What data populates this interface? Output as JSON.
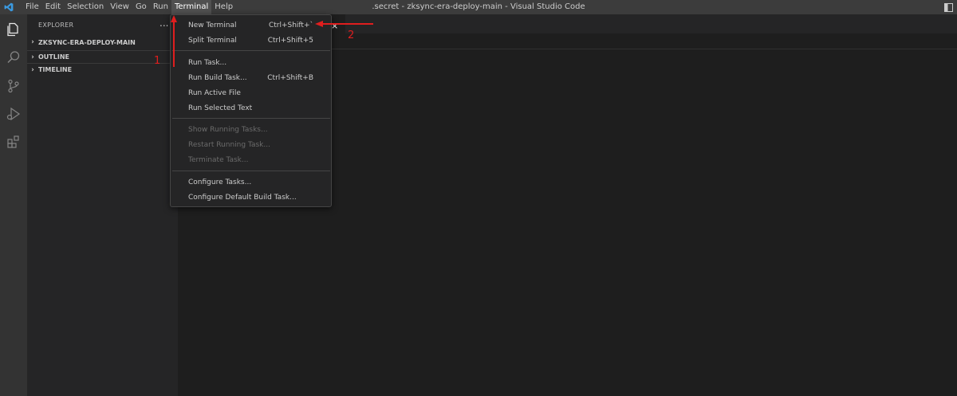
{
  "titlebar": {
    "menu": [
      "File",
      "Edit",
      "Selection",
      "View",
      "Go",
      "Run",
      "Terminal",
      "Help"
    ],
    "active_menu_index": 6,
    "window_title": ".secret - zksync-era-deploy-main - Visual Studio Code"
  },
  "activitybar": {
    "icons": [
      "explorer-icon",
      "search-icon",
      "source-control-icon",
      "run-debug-icon",
      "extensions-icon"
    ]
  },
  "sidebar": {
    "header": "EXPLORER",
    "more": "...",
    "sections": [
      {
        "label": "ZKSYNC-ERA-DEPLOY-MAIN"
      },
      {
        "label": "OUTLINE"
      },
      {
        "label": "TIMELINE"
      }
    ]
  },
  "terminal_menu": {
    "items": [
      {
        "label": "New Terminal",
        "shortcut": "Ctrl+Shift+`",
        "disabled": false
      },
      {
        "label": "Split Terminal",
        "shortcut": "Ctrl+Shift+5",
        "disabled": false
      },
      {
        "label": "Run Task...",
        "shortcut": "",
        "disabled": false
      },
      {
        "label": "Run Build Task...",
        "shortcut": "Ctrl+Shift+B",
        "disabled": false
      },
      {
        "label": "Run Active File",
        "shortcut": "",
        "disabled": false
      },
      {
        "label": "Run Selected Text",
        "shortcut": "",
        "disabled": false
      },
      {
        "label": "Show Running Tasks...",
        "shortcut": "",
        "disabled": true
      },
      {
        "label": "Restart Running Task...",
        "shortcut": "",
        "disabled": true
      },
      {
        "label": "Terminate Task...",
        "shortcut": "",
        "disabled": true
      },
      {
        "label": "Configure Tasks...",
        "shortcut": "",
        "disabled": false
      },
      {
        "label": "Configure Default Build Task...",
        "shortcut": "",
        "disabled": false
      }
    ]
  },
  "annotations": {
    "step1": "1",
    "step2": "2",
    "color": "#e01e1e"
  },
  "editor": {
    "close_symbol": "×"
  }
}
